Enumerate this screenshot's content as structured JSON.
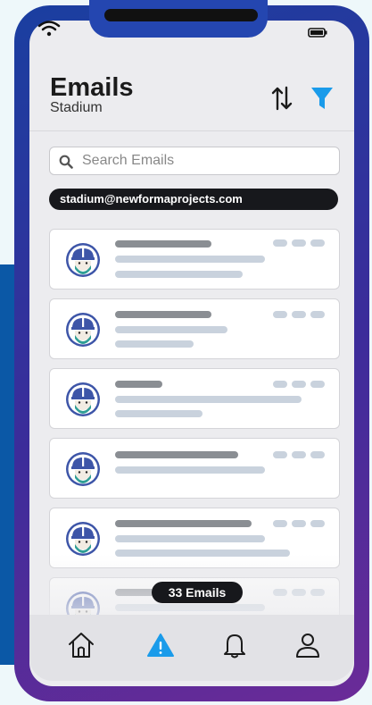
{
  "header": {
    "title": "Emails",
    "subtitle": "Stadium"
  },
  "search": {
    "placeholder": "Search Emails"
  },
  "filter_chip": {
    "label": "stadium@newformaprojects.com"
  },
  "email_count": {
    "label": "33 Emails"
  },
  "colors": {
    "accent": "#1a9bea",
    "phone_frame": "#2446b0",
    "chip_bg": "#17181c"
  },
  "icons": {
    "status": [
      "wifi-icon",
      "battery-icon"
    ],
    "header": [
      "sort-icon",
      "filter-icon"
    ],
    "nav": [
      "home-icon",
      "alert-icon",
      "bell-icon",
      "profile-icon"
    ]
  }
}
